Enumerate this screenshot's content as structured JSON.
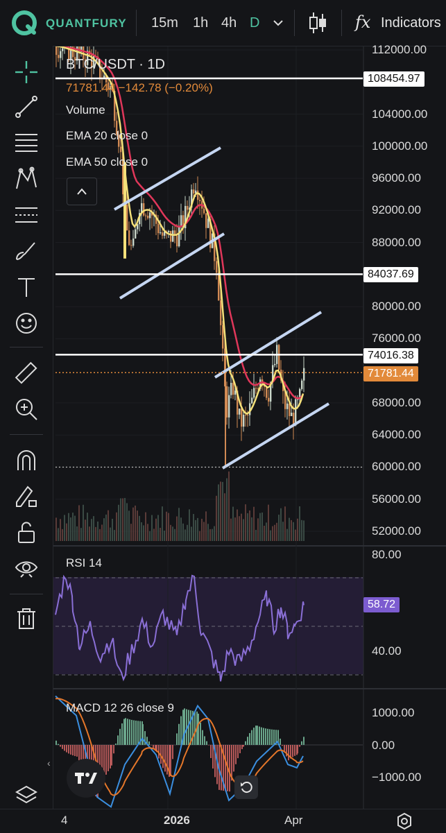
{
  "header": {
    "brand": "QUANTFURY",
    "timeframes": [
      {
        "label": "15m",
        "active": false
      },
      {
        "label": "1h",
        "active": false
      },
      {
        "label": "4h",
        "active": false
      },
      {
        "label": "D",
        "active": true
      }
    ],
    "indicators_label": "Indicators",
    "fx_glyph": "fx"
  },
  "legend": {
    "symbol": "BTC/USDT · 1D",
    "price_line": "71781.44  −142.78 (−0.20%)",
    "volume": "Volume",
    "ema20": "EMA 20 close 0",
    "ema50": "EMA 50 close 0"
  },
  "price_axis": {
    "ticks": [
      "112000.00",
      "104000.00",
      "100000.00",
      "96000.00",
      "92000.00",
      "88000.00",
      "80000.00",
      "76000.00",
      "68000.00",
      "64000.00",
      "60000.00",
      "56000.00",
      "52000.00"
    ],
    "levels": [
      {
        "label": "108454.97",
        "value": 108454.97
      },
      {
        "label": "84037.69",
        "value": 84037.69
      },
      {
        "label": "74016.38",
        "value": 74016.38
      }
    ],
    "current": {
      "label": "71781.44",
      "value": 71781.44
    },
    "dotted_level": 60000
  },
  "rsi": {
    "title": "RSI 14",
    "ticks": [
      "80.00",
      "40.00"
    ],
    "value_label": "58.72"
  },
  "macd": {
    "title": "MACD 12 26 close 9",
    "ticks": [
      "1000.00",
      "0.00",
      "−1000.00"
    ]
  },
  "time_axis": {
    "labels": [
      "4",
      "2026",
      "Apr"
    ]
  },
  "colors": {
    "accent": "#4fc3a1",
    "ema20": "#f5e17a",
    "ema50": "#e0375a",
    "channel": "#c5d6f2",
    "current_price": "#e28a3a",
    "rsi": "#8a6fd6",
    "macd_line": "#3b8fe0",
    "signal_line": "#e5772a"
  },
  "icons": [
    "crosshair-icon",
    "trend-line-icon",
    "fib-icon",
    "pattern-icon",
    "channel-icon",
    "brush-icon",
    "text-icon",
    "emoji-icon",
    "ruler-icon",
    "zoom-in-icon",
    "magnet-icon",
    "lock-drawing-icon",
    "unlock-icon",
    "eye-icon",
    "trash-icon",
    "layers-icon",
    "collapse-chevron-icon",
    "replay-icon",
    "settings-icon",
    "tradingview-logo-icon"
  ]
}
